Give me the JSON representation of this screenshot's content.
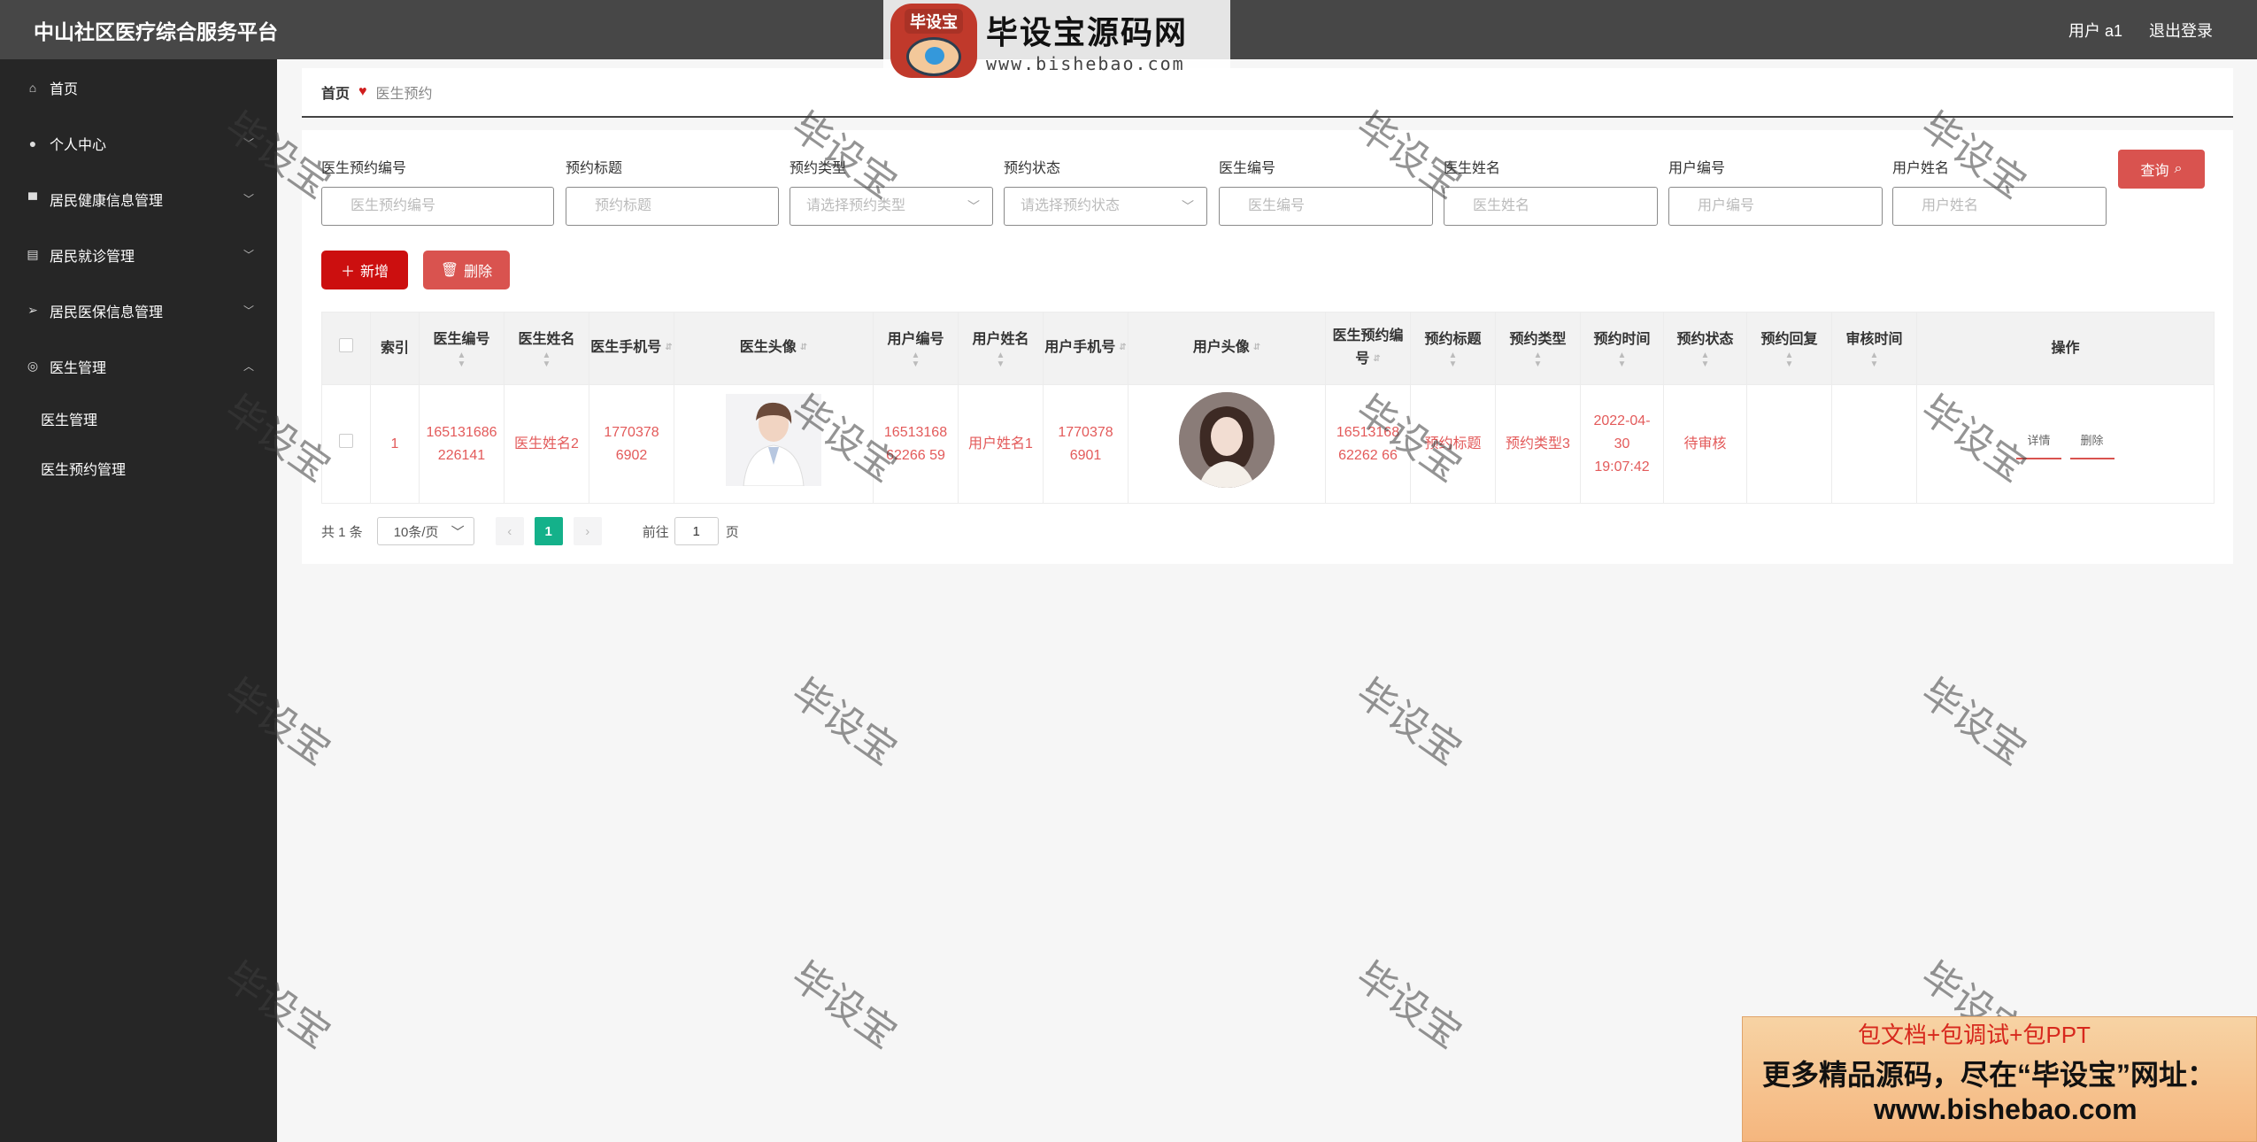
{
  "header": {
    "app_title": "中山社区医疗综合服务平台",
    "user_label": "用户 a1",
    "logout": "退出登录"
  },
  "sidebar": {
    "items": [
      {
        "label": "首页",
        "icon": "home-icon"
      },
      {
        "label": "个人中心",
        "icon": "user-icon"
      },
      {
        "label": "居民健康信息管理",
        "icon": "monitor-icon"
      },
      {
        "label": "居民就诊管理",
        "icon": "clipboard-icon"
      },
      {
        "label": "居民医保信息管理",
        "icon": "send-icon"
      },
      {
        "label": "医生管理",
        "icon": "circle-icon"
      }
    ],
    "sub_items": [
      "医生管理",
      "医生预约管理"
    ]
  },
  "breadcrumb": {
    "home": "首页",
    "current": "医生预约"
  },
  "search": {
    "fields": [
      {
        "label": "医生预约编号",
        "placeholder": "医生预约编号"
      },
      {
        "label": "预约标题",
        "placeholder": "预约标题"
      },
      {
        "label": "预约类型",
        "placeholder": "请选择预约类型"
      },
      {
        "label": "预约状态",
        "placeholder": "请选择预约状态"
      },
      {
        "label": "医生编号",
        "placeholder": "医生编号"
      },
      {
        "label": "医生姓名",
        "placeholder": "医生姓名"
      },
      {
        "label": "用户编号",
        "placeholder": "用户编号"
      },
      {
        "label": "用户姓名",
        "placeholder": "用户姓名"
      }
    ],
    "query_label": "查询"
  },
  "actions": {
    "add": "新增",
    "delete": "删除"
  },
  "table": {
    "headers": [
      "索引",
      "医生编号",
      "医生姓名",
      "医生手机号",
      "医生头像",
      "用户编号",
      "用户姓名",
      "用户手机号",
      "用户头像",
      "医生预约编号",
      "预约标题",
      "预约类型",
      "预约时间",
      "预约状态",
      "预约回复",
      "审核时间",
      "操作"
    ],
    "rows": [
      {
        "index": "1",
        "doctor_no": "165131686226141",
        "doctor_name": "医生姓名2",
        "doctor_phone": "17703786902",
        "user_no": "1651316862266 59",
        "user_name": "用户姓名1",
        "user_phone": "17703786901",
        "appt_no": "1651316862262 66",
        "appt_title": "预约标题",
        "appt_type": "预约类型3",
        "appt_time": "2022-04-30 19:07:42",
        "appt_status": "待审核",
        "appt_reply": "",
        "review_time": "",
        "op_detail": "详情",
        "op_delete": "删除"
      }
    ]
  },
  "pagination": {
    "total": "共 1 条",
    "page_size": "10条/页",
    "current_page": "1",
    "goto_prefix": "前往",
    "goto_value": "1",
    "goto_suffix": "页"
  },
  "watermark": {
    "text": "毕设宝",
    "logo_badge": "毕设宝",
    "logo_main": "毕设宝源码网",
    "logo_url": "www.bishebao.com"
  },
  "promo": {
    "line1": "包文档+包调试+包PPT",
    "line2": "更多精品源码，尽在“毕设宝”网址：",
    "line3": "www.bishebao.com"
  },
  "colors": {
    "topbar": "#474747",
    "sidebar": "#262626",
    "accent_red": "#d9534f",
    "add_red": "#cc0f0f",
    "page_active": "#14b18a"
  }
}
